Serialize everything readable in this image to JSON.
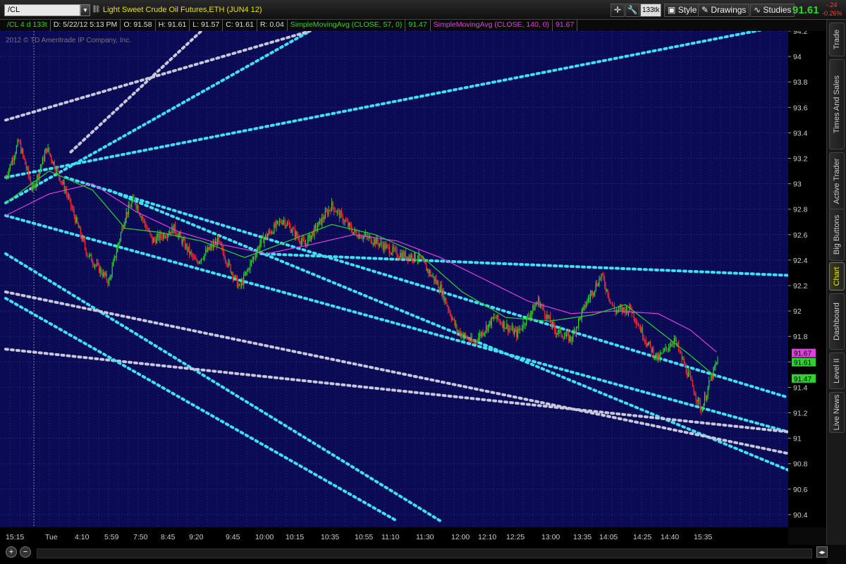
{
  "toolbar": {
    "symbol": "/CL",
    "description": "Light Sweet Crude Oil Futures,ETH (JUN4 12)",
    "tick_badge": "133tk",
    "style_label": "Style",
    "drawings_label": "Drawings",
    "studies_label": "Studies",
    "last_price": "91.61",
    "change_abs": "-.24",
    "change_pct": "-0.26%"
  },
  "info_bar": {
    "symbol_period": "/CL 4 d 133t",
    "date": "D: 5/22/12 5:13 PM",
    "open": "O: 91.58",
    "high": "H: 91.61",
    "low": "L: 91.57",
    "close": "C: 91.61",
    "range": "R: 0.04",
    "sma1_label": "SimpleMovingAvg (CLOSE, 57, 0)",
    "sma1_value": "91.47",
    "sma2_label": "SimpleMovingAvg (CLOSE, 140, 0)",
    "sma2_value": "91.67"
  },
  "copyright": "2012 © TD Ameritrade IP Company, Inc.",
  "right_tabs": [
    "Trade",
    "Times And Sales",
    "Active Trader",
    "Big Buttons",
    "Chart",
    "Dashboard",
    "Level II",
    "Live News"
  ],
  "active_tab": "Chart",
  "colors": {
    "background": "#0a0a55",
    "price_up": "#2bd62b",
    "price_down": "#ff2a2a",
    "sma57": "#2bd62b",
    "sma140": "#e040e0",
    "trend_cyan": "#40e0f0",
    "trend_gray": "#c8c8d8",
    "description_yellow": "#e5e500"
  },
  "chart_data": {
    "type": "candlestick",
    "symbol": "/CL",
    "ylim": [
      90.3,
      94.2
    ],
    "y_ticks": [
      "94.2",
      "94",
      "93.8",
      "93.6",
      "93.4",
      "93.2",
      "93",
      "92.8",
      "92.6",
      "92.4",
      "92.2",
      "92",
      "91.8",
      "91.6",
      "91.4",
      "91.2",
      "91",
      "90.8",
      "90.6",
      "90.4"
    ],
    "x_labels": [
      "15:15",
      "Tue",
      "4:10",
      "5:59",
      "7:50",
      "8:45",
      "9:20",
      "9:45",
      "10:00",
      "10:15",
      "10:35",
      "10:55",
      "11:10",
      "11:30",
      "12:00",
      "12:10",
      "12:25",
      "13:00",
      "13:35",
      "14:05",
      "14:25",
      "14:40",
      "15:35"
    ],
    "price_key": [
      {
        "bar": 0,
        "close": 93.05
      },
      {
        "bar": 12,
        "close": 93.33
      },
      {
        "bar": 25,
        "close": 92.95
      },
      {
        "bar": 38,
        "close": 93.28
      },
      {
        "bar": 55,
        "close": 92.95
      },
      {
        "bar": 75,
        "close": 92.45
      },
      {
        "bar": 95,
        "close": 92.23
      },
      {
        "bar": 110,
        "close": 92.75
      },
      {
        "bar": 118,
        "close": 92.88
      },
      {
        "bar": 135,
        "close": 92.55
      },
      {
        "bar": 155,
        "close": 92.65
      },
      {
        "bar": 175,
        "close": 92.38
      },
      {
        "bar": 195,
        "close": 92.55
      },
      {
        "bar": 215,
        "close": 92.18
      },
      {
        "bar": 235,
        "close": 92.55
      },
      {
        "bar": 255,
        "close": 92.72
      },
      {
        "bar": 275,
        "close": 92.52
      },
      {
        "bar": 300,
        "close": 92.83
      },
      {
        "bar": 320,
        "close": 92.62
      },
      {
        "bar": 340,
        "close": 92.55
      },
      {
        "bar": 360,
        "close": 92.45
      },
      {
        "bar": 380,
        "close": 92.42
      },
      {
        "bar": 400,
        "close": 92.18
      },
      {
        "bar": 415,
        "close": 91.85
      },
      {
        "bar": 430,
        "close": 91.75
      },
      {
        "bar": 450,
        "close": 91.95
      },
      {
        "bar": 470,
        "close": 91.82
      },
      {
        "bar": 490,
        "close": 92.08
      },
      {
        "bar": 505,
        "close": 91.85
      },
      {
        "bar": 520,
        "close": 91.78
      },
      {
        "bar": 535,
        "close": 92.08
      },
      {
        "bar": 548,
        "close": 92.28
      },
      {
        "bar": 560,
        "close": 92.0
      },
      {
        "bar": 575,
        "close": 92.02
      },
      {
        "bar": 590,
        "close": 91.75
      },
      {
        "bar": 600,
        "close": 91.62
      },
      {
        "bar": 615,
        "close": 91.78
      },
      {
        "bar": 630,
        "close": 91.45
      },
      {
        "bar": 640,
        "close": 91.22
      },
      {
        "bar": 648,
        "close": 91.45
      },
      {
        "bar": 655,
        "close": 91.61
      }
    ],
    "total_bars": 656,
    "sma57_key": [
      {
        "bar": 0,
        "value": 92.85
      },
      {
        "bar": 40,
        "value": 93.1
      },
      {
        "bar": 80,
        "value": 92.95
      },
      {
        "bar": 110,
        "value": 92.65
      },
      {
        "bar": 140,
        "value": 92.62
      },
      {
        "bar": 180,
        "value": 92.55
      },
      {
        "bar": 220,
        "value": 92.42
      },
      {
        "bar": 260,
        "value": 92.55
      },
      {
        "bar": 300,
        "value": 92.68
      },
      {
        "bar": 340,
        "value": 92.6
      },
      {
        "bar": 380,
        "value": 92.45
      },
      {
        "bar": 420,
        "value": 92.15
      },
      {
        "bar": 460,
        "value": 91.95
      },
      {
        "bar": 500,
        "value": 91.92
      },
      {
        "bar": 540,
        "value": 91.97
      },
      {
        "bar": 570,
        "value": 92.05
      },
      {
        "bar": 600,
        "value": 91.85
      },
      {
        "bar": 630,
        "value": 91.65
      },
      {
        "bar": 655,
        "value": 91.47
      }
    ],
    "sma140_key": [
      {
        "bar": 0,
        "value": 92.75
      },
      {
        "bar": 40,
        "value": 92.92
      },
      {
        "bar": 80,
        "value": 93.0
      },
      {
        "bar": 120,
        "value": 92.78
      },
      {
        "bar": 160,
        "value": 92.62
      },
      {
        "bar": 200,
        "value": 92.52
      },
      {
        "bar": 240,
        "value": 92.45
      },
      {
        "bar": 280,
        "value": 92.52
      },
      {
        "bar": 320,
        "value": 92.6
      },
      {
        "bar": 360,
        "value": 92.55
      },
      {
        "bar": 400,
        "value": 92.42
      },
      {
        "bar": 440,
        "value": 92.25
      },
      {
        "bar": 480,
        "value": 92.08
      },
      {
        "bar": 520,
        "value": 91.98
      },
      {
        "bar": 560,
        "value": 92.0
      },
      {
        "bar": 600,
        "value": 91.98
      },
      {
        "bar": 630,
        "value": 91.85
      },
      {
        "bar": 655,
        "value": 91.67
      }
    ],
    "price_tags": [
      {
        "label": "91.67",
        "value": 91.67,
        "color": "#e040e0"
      },
      {
        "label": "91.61",
        "value": 91.61,
        "color": "#2bd62b"
      },
      {
        "label": "91.47",
        "value": 91.47,
        "color": "#2bd62b"
      }
    ],
    "trendlines": [
      {
        "color": "trend_cyan",
        "from": {
          "bar": 0,
          "price": 93.05
        },
        "to": {
          "bar": 720,
          "price": 94.25
        }
      },
      {
        "color": "trend_cyan",
        "from": {
          "bar": 0,
          "price": 92.85
        },
        "to": {
          "bar": 280,
          "price": 94.2
        }
      },
      {
        "color": "trend_gray",
        "from": {
          "bar": 0,
          "price": 93.5
        },
        "to": {
          "bar": 280,
          "price": 94.2
        }
      },
      {
        "color": "trend_gray",
        "from": {
          "bar": 60,
          "price": 93.25
        },
        "to": {
          "bar": 180,
          "price": 94.2
        }
      },
      {
        "color": "trend_cyan",
        "from": {
          "bar": 55,
          "price": 93.05
        },
        "to": {
          "bar": 720,
          "price": 91.32
        }
      },
      {
        "color": "trend_cyan",
        "from": {
          "bar": 95,
          "price": 92.95
        },
        "to": {
          "bar": 720,
          "price": 90.75
        }
      },
      {
        "color": "trend_cyan",
        "from": {
          "bar": 235,
          "price": 92.45
        },
        "to": {
          "bar": 720,
          "price": 92.28
        }
      },
      {
        "color": "trend_cyan",
        "from": {
          "bar": 0,
          "price": 92.45
        },
        "to": {
          "bar": 400,
          "price": 90.35
        }
      },
      {
        "color": "trend_cyan",
        "from": {
          "bar": 0,
          "price": 92.75
        },
        "to": {
          "bar": 720,
          "price": 91.05
        }
      },
      {
        "color": "trend_gray",
        "from": {
          "bar": 0,
          "price": 92.15
        },
        "to": {
          "bar": 720,
          "price": 90.88
        }
      },
      {
        "color": "trend_gray",
        "from": {
          "bar": 0,
          "price": 91.7
        },
        "to": {
          "bar": 720,
          "price": 91.05
        }
      },
      {
        "color": "trend_cyan",
        "from": {
          "bar": 0,
          "price": 92.1
        },
        "to": {
          "bar": 360,
          "price": 90.35
        }
      }
    ]
  }
}
